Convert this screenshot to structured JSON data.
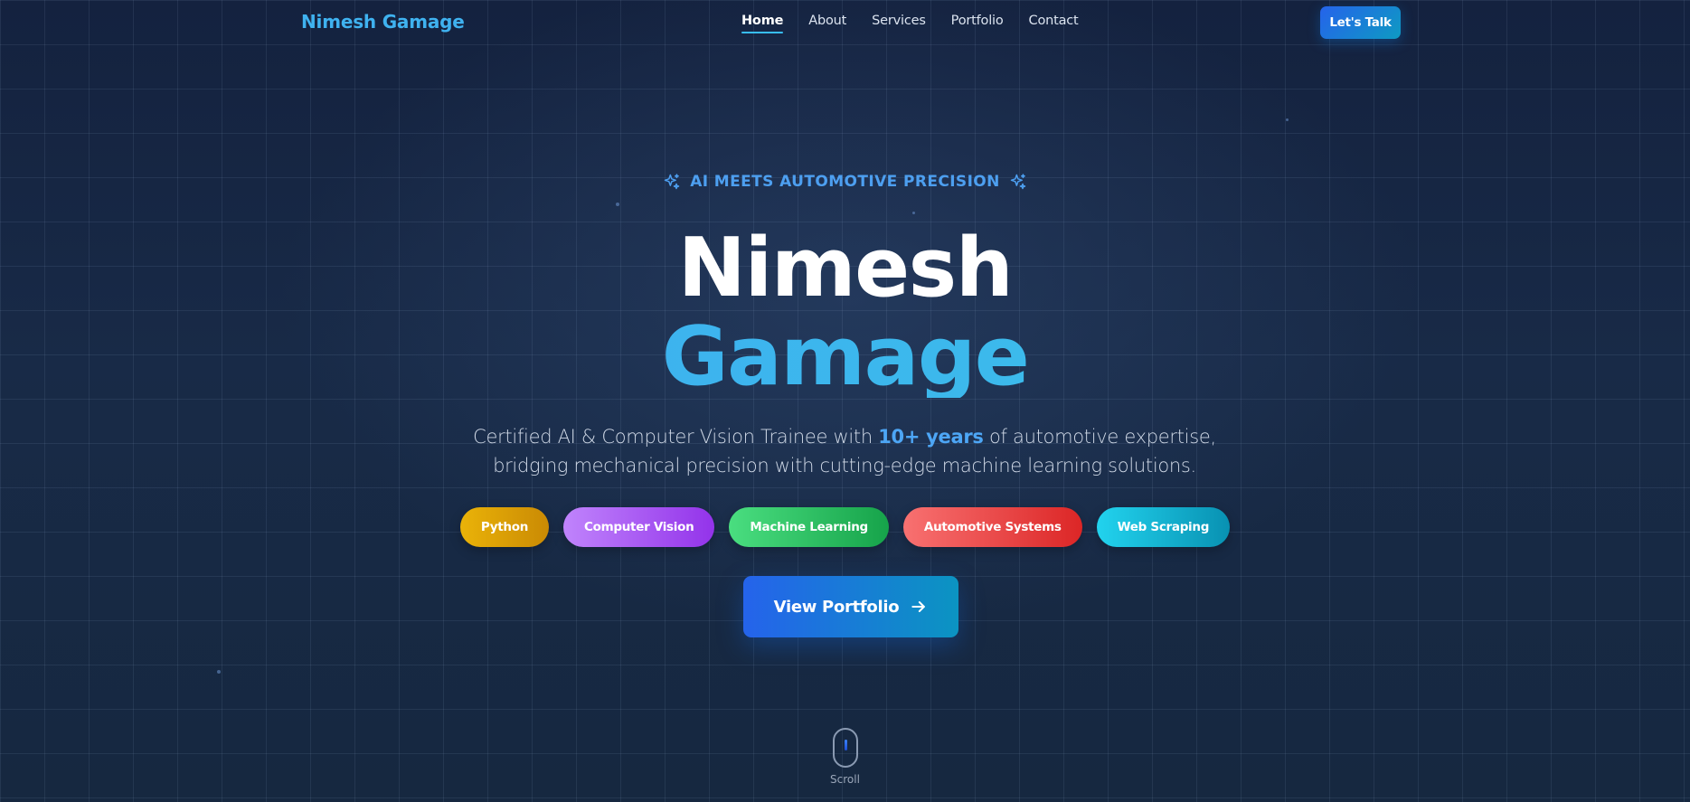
{
  "nav": {
    "brand": "Nimesh Gamage",
    "links": [
      {
        "label": "Home",
        "active": true
      },
      {
        "label": "About",
        "active": false
      },
      {
        "label": "Services",
        "active": false
      },
      {
        "label": "Portfolio",
        "active": false
      },
      {
        "label": "Contact",
        "active": false
      }
    ],
    "cta_label": "Let's Talk"
  },
  "hero": {
    "eyebrow": "AI MEETS AUTOMOTIVE PRECISION",
    "first_name": "Nimesh",
    "last_name": "Gamage",
    "tagline_before": "Certified AI & Computer Vision Trainee with ",
    "tagline_highlight": "10+ years",
    "tagline_after": " of automotive expertise, bridging mechanical precision with cutting-edge machine learning solutions.",
    "skills": [
      {
        "label": "Python",
        "color_from": "#eab308",
        "color_to": "#ca8a04"
      },
      {
        "label": "Computer Vision",
        "color_from": "#c084fc",
        "color_to": "#9333ea"
      },
      {
        "label": "Machine Learning",
        "color_from": "#4ade80",
        "color_to": "#16a34a"
      },
      {
        "label": "Automotive Systems",
        "color_from": "#f87171",
        "color_to": "#dc2626"
      },
      {
        "label": "Web Scraping",
        "color_from": "#22d3ee",
        "color_to": "#0891b2"
      }
    ],
    "cta_label": "View Portfolio",
    "cta_icon": "arrow-right-icon",
    "scroll_label": "Scroll"
  },
  "colors": {
    "accent": "#38bdf8",
    "highlight": "#4da6f5",
    "background": "#172843"
  }
}
